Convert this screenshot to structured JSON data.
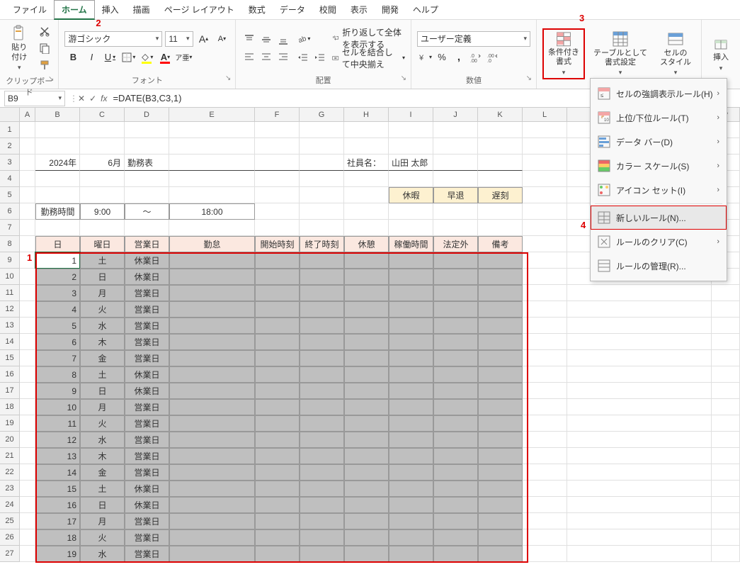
{
  "menu": {
    "items": [
      "ファイル",
      "ホーム",
      "挿入",
      "描画",
      "ページ レイアウト",
      "数式",
      "データ",
      "校閲",
      "表示",
      "開発",
      "ヘルプ"
    ],
    "active_index": 1
  },
  "annotations": {
    "n1": "1",
    "n2": "2",
    "n3": "3",
    "n4": "4"
  },
  "ribbon": {
    "clipboard": {
      "label": "クリップボード",
      "paste": "貼り付け"
    },
    "font": {
      "label": "フォント",
      "name": "游ゴシック",
      "size": "11",
      "bold": "B",
      "italic": "I",
      "underline": "U"
    },
    "alignment": {
      "label": "配置",
      "wrap": "折り返して全体を表示する",
      "merge": "セルを結合して中央揃え"
    },
    "number": {
      "label": "数値",
      "format": "ユーザー定義"
    },
    "styles": {
      "cond": "条件付き\n書式",
      "table": "テーブルとして\n書式設定",
      "cell": "セルの\nスタイル"
    },
    "cells": {
      "insert": "挿入"
    }
  },
  "formulabar": {
    "name": "B9",
    "formula": "=DATE(B3,C3,1)"
  },
  "columns": [
    "A",
    "B",
    "C",
    "D",
    "E",
    "F",
    "G",
    "H",
    "I",
    "J",
    "K",
    "L"
  ],
  "col_p": "P",
  "sheet": {
    "r3": {
      "year": "2024年",
      "month": "6月",
      "title": "勤務表",
      "emp_label": "社員名：",
      "emp": "山田 太郎"
    },
    "r5": {
      "vac": "休暇",
      "early": "早退",
      "late": "遅刻"
    },
    "r6": {
      "label": "勤務時間",
      "start": "9:00",
      "sep": "～",
      "end": "18:00"
    },
    "headers": [
      "日",
      "曜日",
      "営業日",
      "勤怠",
      "開始時刻",
      "終了時刻",
      "休憩",
      "稼働時間",
      "法定外",
      "備考"
    ],
    "data": [
      {
        "d": "1",
        "w": "土",
        "b": "休業日"
      },
      {
        "d": "2",
        "w": "日",
        "b": "休業日"
      },
      {
        "d": "3",
        "w": "月",
        "b": "営業日"
      },
      {
        "d": "4",
        "w": "火",
        "b": "営業日"
      },
      {
        "d": "5",
        "w": "水",
        "b": "営業日"
      },
      {
        "d": "6",
        "w": "木",
        "b": "営業日"
      },
      {
        "d": "7",
        "w": "金",
        "b": "営業日"
      },
      {
        "d": "8",
        "w": "土",
        "b": "休業日"
      },
      {
        "d": "9",
        "w": "日",
        "b": "休業日"
      },
      {
        "d": "10",
        "w": "月",
        "b": "営業日"
      },
      {
        "d": "11",
        "w": "火",
        "b": "営業日"
      },
      {
        "d": "12",
        "w": "水",
        "b": "営業日"
      },
      {
        "d": "13",
        "w": "木",
        "b": "営業日"
      },
      {
        "d": "14",
        "w": "金",
        "b": "営業日"
      },
      {
        "d": "15",
        "w": "土",
        "b": "休業日"
      },
      {
        "d": "16",
        "w": "日",
        "b": "休業日"
      },
      {
        "d": "17",
        "w": "月",
        "b": "営業日"
      },
      {
        "d": "18",
        "w": "火",
        "b": "営業日"
      },
      {
        "d": "19",
        "w": "水",
        "b": "営業日"
      }
    ]
  },
  "dropdown": {
    "items": [
      {
        "label": "セルの強調表示ルール(H)",
        "chev": true
      },
      {
        "label": "上位/下位ルール(T)",
        "chev": true
      },
      {
        "label": "データ バー(D)",
        "chev": true
      },
      {
        "label": "カラー スケール(S)",
        "chev": true
      },
      {
        "label": "アイコン セット(I)",
        "chev": true
      }
    ],
    "new_rule": "新しいルール(N)...",
    "clear": "ルールのクリア(C)",
    "manage": "ルールの管理(R)..."
  }
}
